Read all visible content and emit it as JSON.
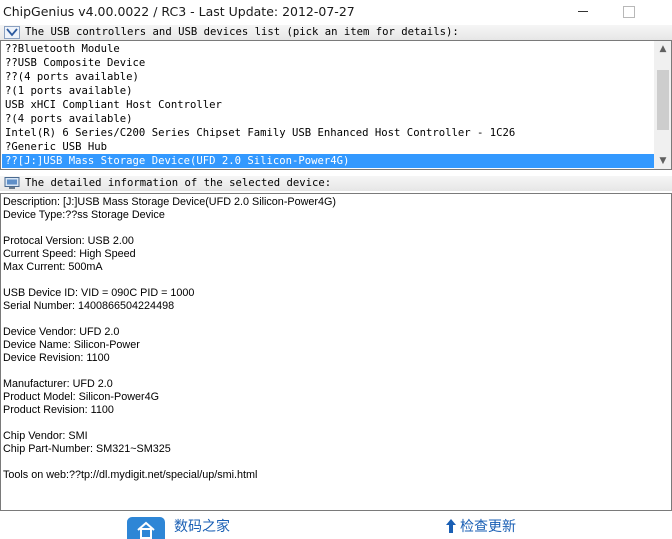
{
  "window": {
    "title": "ChipGenius v4.00.0022 / RC3 - Last Update: 2012-07-27"
  },
  "usb_list": {
    "header": "The USB controllers and USB devices list (pick an item for details):",
    "icon": "usb-arrow-icon",
    "items": [
      "??Bluetooth Module",
      "??USB Composite Device",
      "??(4 ports available)",
      "?(1 ports available)",
      "USB xHCI Compliant Host Controller",
      "?(4 ports available)",
      "Intel(R) 6 Series/C200 Series Chipset Family USB Enhanced Host Controller - 1C26",
      "?Generic USB Hub",
      "??[J:]USB Mass Storage Device(UFD 2.0 Silicon-Power4G)"
    ],
    "selected_index": 8
  },
  "details": {
    "header": "The detailed information of the selected device:",
    "icon": "monitor-icon",
    "lines": [
      "Description: [J:]USB Mass Storage Device(UFD 2.0 Silicon-Power4G)",
      "Device Type:??ss Storage Device",
      "",
      "Protocal Version: USB 2.00",
      "Current Speed: High Speed",
      "Max Current: 500mA",
      "",
      "USB Device ID: VID = 090C PID = 1000",
      "Serial Number: 1400866504224498",
      "",
      "Device Vendor: UFD 2.0",
      "Device Name: Silicon-Power",
      "Device Revision: 1100",
      "",
      "Manufacturer: UFD 2.0",
      "Product Model: Silicon-Power4G",
      "Product Revision: 1100",
      "",
      "Chip Vendor: SMI",
      "Chip Part-Number: SM321~SM325",
      "",
      "Tools on web:??tp://dl.mydigit.net/special/up/smi.html"
    ]
  },
  "footer": {
    "home_label": "数码之家",
    "home_icon": "house-icon",
    "update_label": "检查更新",
    "update_icon": "up-arrow-icon",
    "accent": "#1a5fb4"
  },
  "colors": {
    "selection": "#3399ff"
  }
}
